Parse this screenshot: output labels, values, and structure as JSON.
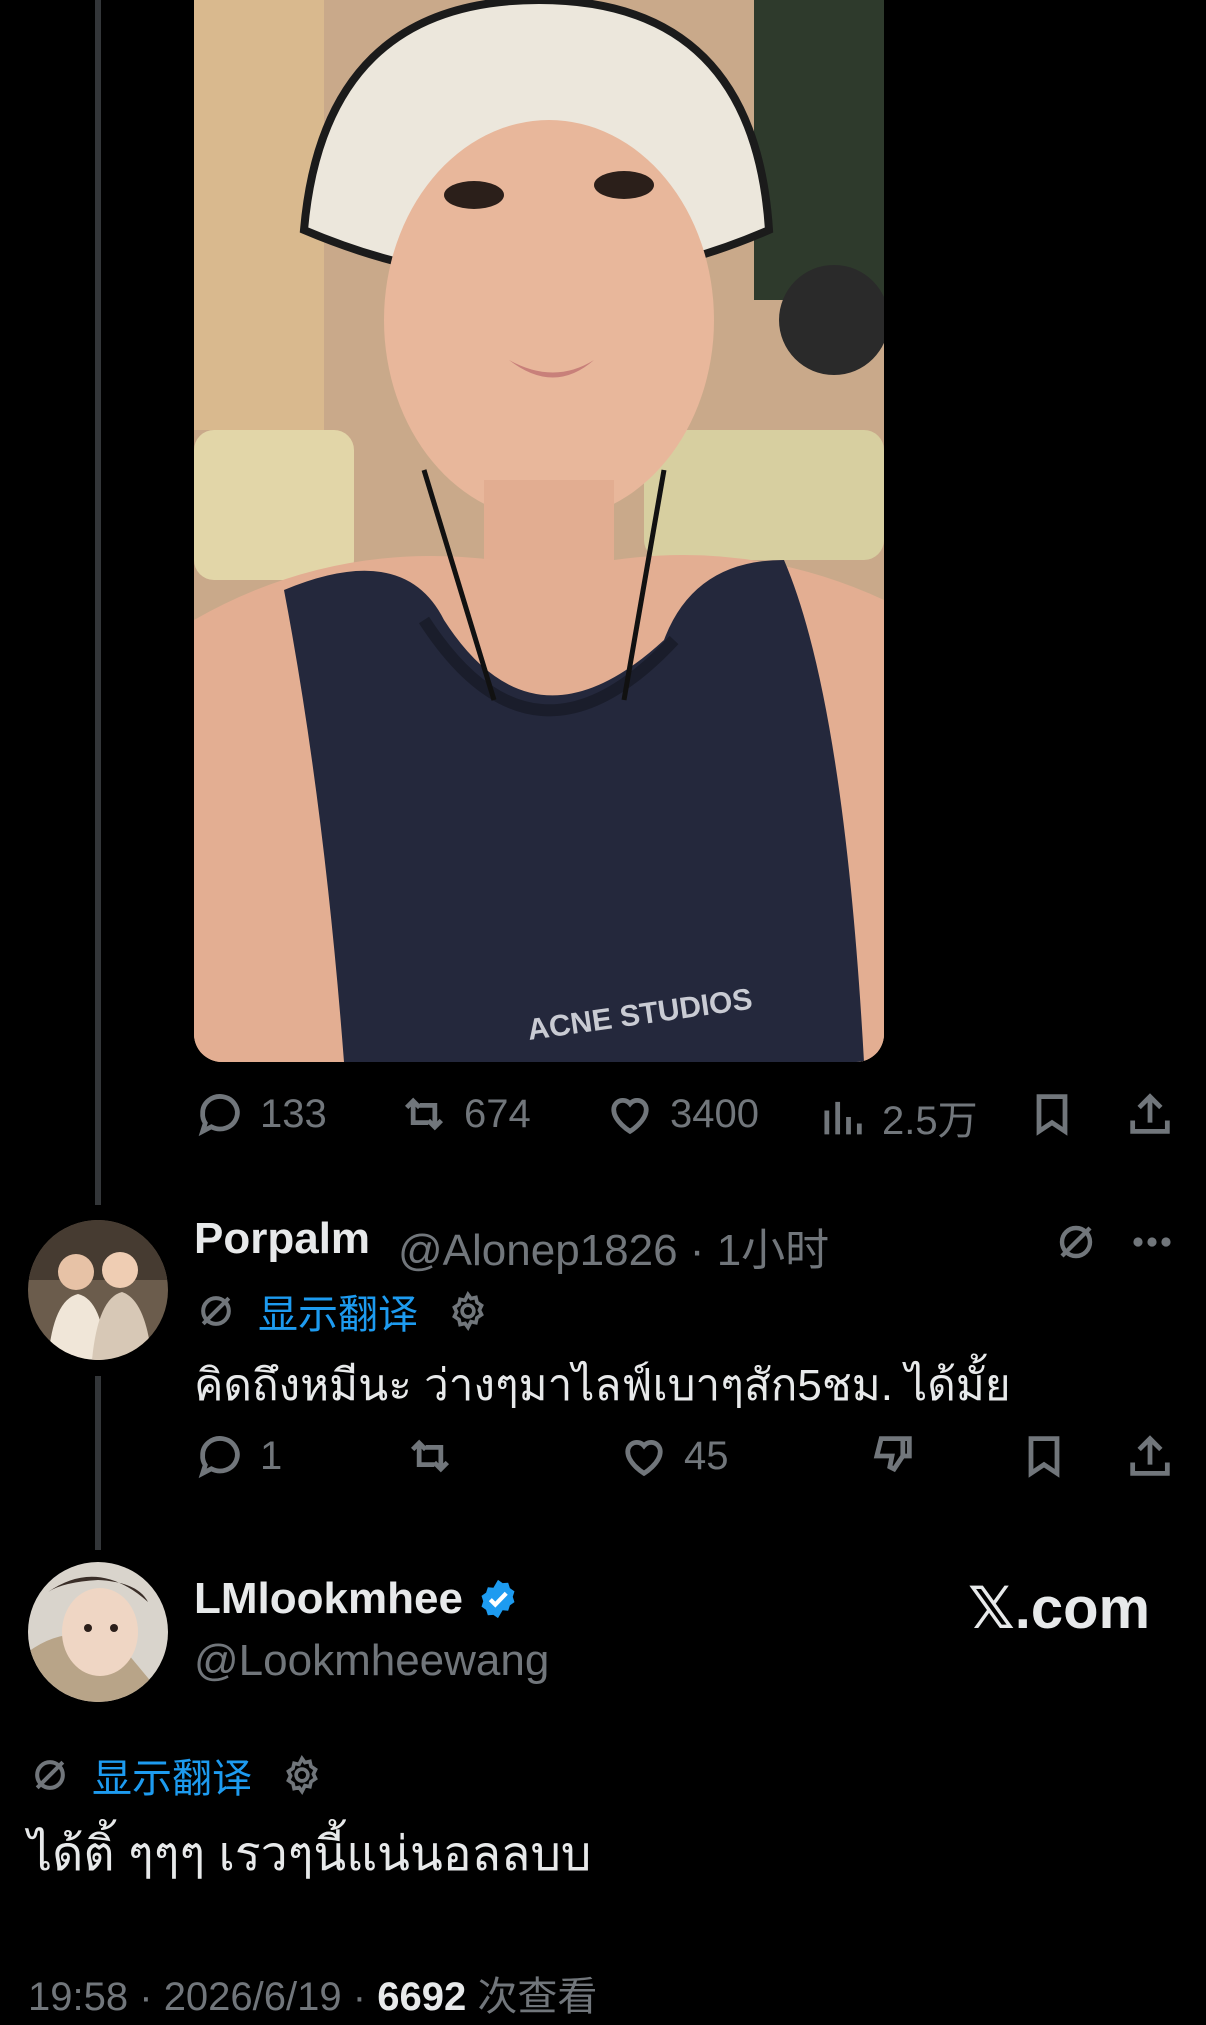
{
  "main_post": {
    "stats": {
      "replies": "133",
      "reposts": "674",
      "likes": "3400",
      "views": "2.5万"
    }
  },
  "reply": {
    "name": "Porpalm",
    "handle": "@Alonep1826",
    "separator": "·",
    "time": "1小时",
    "translate_label": "显示翻译",
    "text": "คิดถึงหมีนะ ว่างๆมาไลฟ์เบาๆสัก5ชม. ได้มั้ย",
    "stats": {
      "replies": "1",
      "reposts": "",
      "likes": "45"
    }
  },
  "focus_post": {
    "name": "LMlookmhee",
    "handle": "@Lookmheewang",
    "translate_label": "显示翻译",
    "text": "ได้ติ้ ๆๆๆ เรวๆนี้แน่นอลลบบ",
    "time": "19:58",
    "sep1": "·",
    "date": "2026/6/19",
    "sep2": "·",
    "views_count": "6692",
    "views_label": "次查看"
  },
  "brand": "𝕏.com",
  "colors": {
    "accent": "#1d9bf0",
    "muted": "#71767b",
    "text": "#e7e9ea",
    "background": "#000000"
  }
}
